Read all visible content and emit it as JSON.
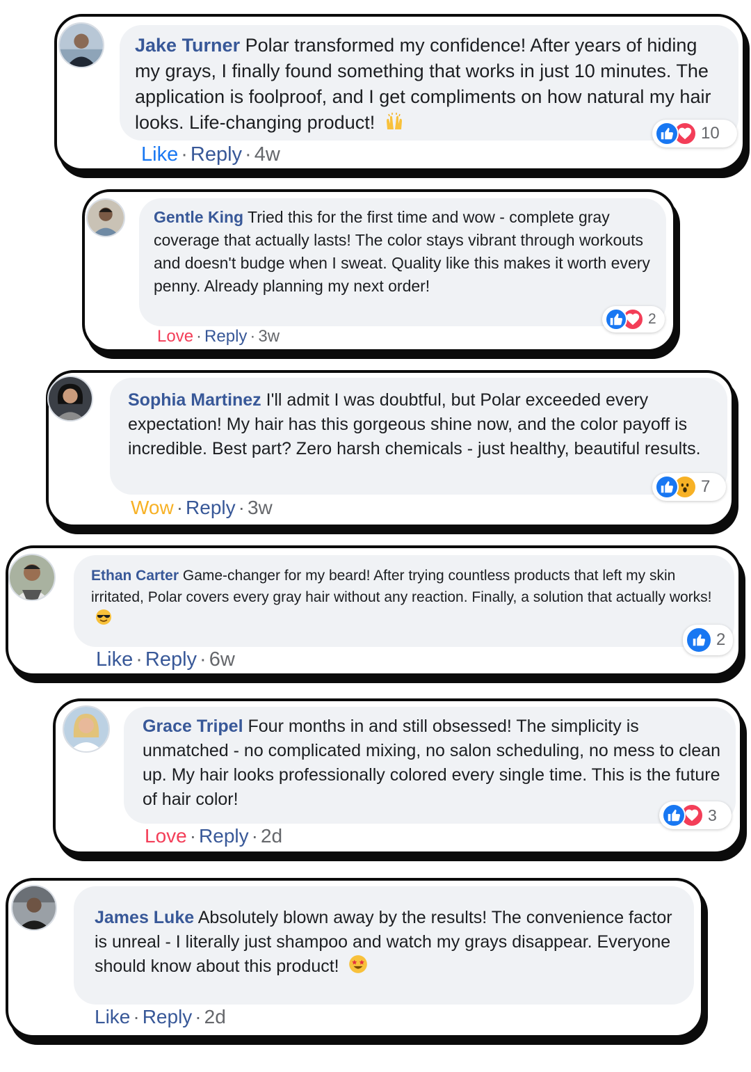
{
  "colors": {
    "name": "#385898",
    "link": "#385898",
    "meta": "#65676b",
    "bubble": "#f0f2f5",
    "like": "#1877f2",
    "love": "#f33e58",
    "wow": "#f7b125",
    "card_border": "#0b0b0b"
  },
  "comments": [
    {
      "name": "Jake Turner",
      "text": "Polar transformed my confidence! After years of hiding my grays, I finally found something that works in just 10 minutes. The application is foolproof, and I get compliments on how natural my hair looks. Life-changing product!",
      "emoji_icon": "raised-hands-icon",
      "reaction_label": "Like",
      "reply_label": "Reply",
      "time": "4w",
      "reaction_icons": [
        "like-icon",
        "love-icon"
      ],
      "reaction_count": "10"
    },
    {
      "name": "Gentle King",
      "text": "Tried this for the first time and wow - complete gray coverage that actually lasts! The color stays vibrant through workouts and doesn't budge when I sweat. Quality like this makes it worth every penny. Already planning my next order!",
      "reaction_label": "Love",
      "reply_label": "Reply",
      "time": "3w",
      "reaction_icons": [
        "like-icon",
        "love-icon"
      ],
      "reaction_count": "2"
    },
    {
      "name": "Sophia Martinez",
      "text": "I'll admit I was doubtful, but Polar exceeded every expectation! My hair has this gorgeous shine now, and the color payoff is incredible. Best part? Zero harsh chemicals - just healthy, beautiful results.",
      "reaction_label": "Wow",
      "reply_label": "Reply",
      "time": "3w",
      "reaction_icons": [
        "like-icon",
        "wow-icon"
      ],
      "reaction_count": "7"
    },
    {
      "name": "Ethan Carter",
      "text": "Game-changer for my beard! After trying countless products that left my skin irritated, Polar covers every gray hair without any reaction. Finally, a solution that actually works!",
      "emoji_icon": "sunglasses-face-icon",
      "reaction_label": "Like",
      "reply_label": "Reply",
      "time": "6w",
      "reaction_icons": [
        "like-icon"
      ],
      "reaction_count": "2"
    },
    {
      "name": "Grace Tripel",
      "text": "Four months in and still obsessed! The simplicity is unmatched - no complicated mixing, no salon scheduling, no mess to clean up. My hair looks professionally colored every single time. This is the future of hair color!",
      "reaction_label": "Love",
      "reply_label": "Reply",
      "time": "2d",
      "reaction_icons": [
        "like-icon",
        "love-icon"
      ],
      "reaction_count": "3"
    },
    {
      "name": "James Luke",
      "text": "Absolutely blown away by the results! The convenience factor is unreal - I literally just shampoo and watch my grays disappear. Everyone should know about this product!",
      "emoji_icon": "star-struck-face-icon",
      "reaction_label": "Like",
      "reply_label": "Reply",
      "time": "2d"
    }
  ]
}
